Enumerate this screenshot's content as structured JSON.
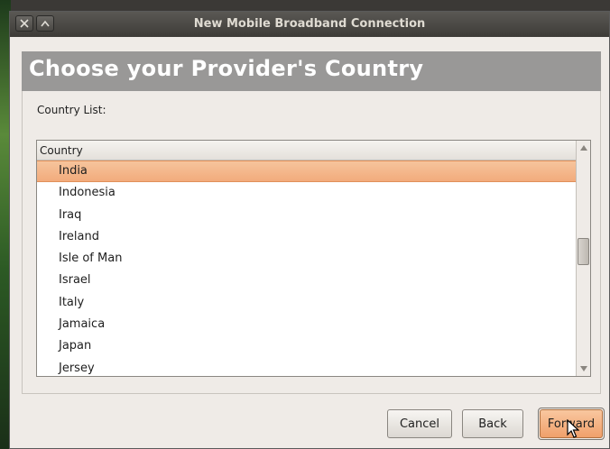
{
  "window": {
    "title": "New Mobile Broadband Connection"
  },
  "banner": {
    "heading": "Choose your Provider's Country"
  },
  "country_list": {
    "label": "Country List:",
    "column_header": "Country",
    "selected": "India",
    "items": [
      "India",
      "Indonesia",
      "Iraq",
      "Ireland",
      "Isle of Man",
      "Israel",
      "Italy",
      "Jamaica",
      "Japan",
      "Jersey"
    ]
  },
  "buttons": {
    "cancel": "Cancel",
    "back": "Back",
    "forward": "Forward"
  },
  "colors": {
    "selection": "#f2ab7c",
    "banner": "#999897",
    "titlebar": "#3d3b37"
  }
}
